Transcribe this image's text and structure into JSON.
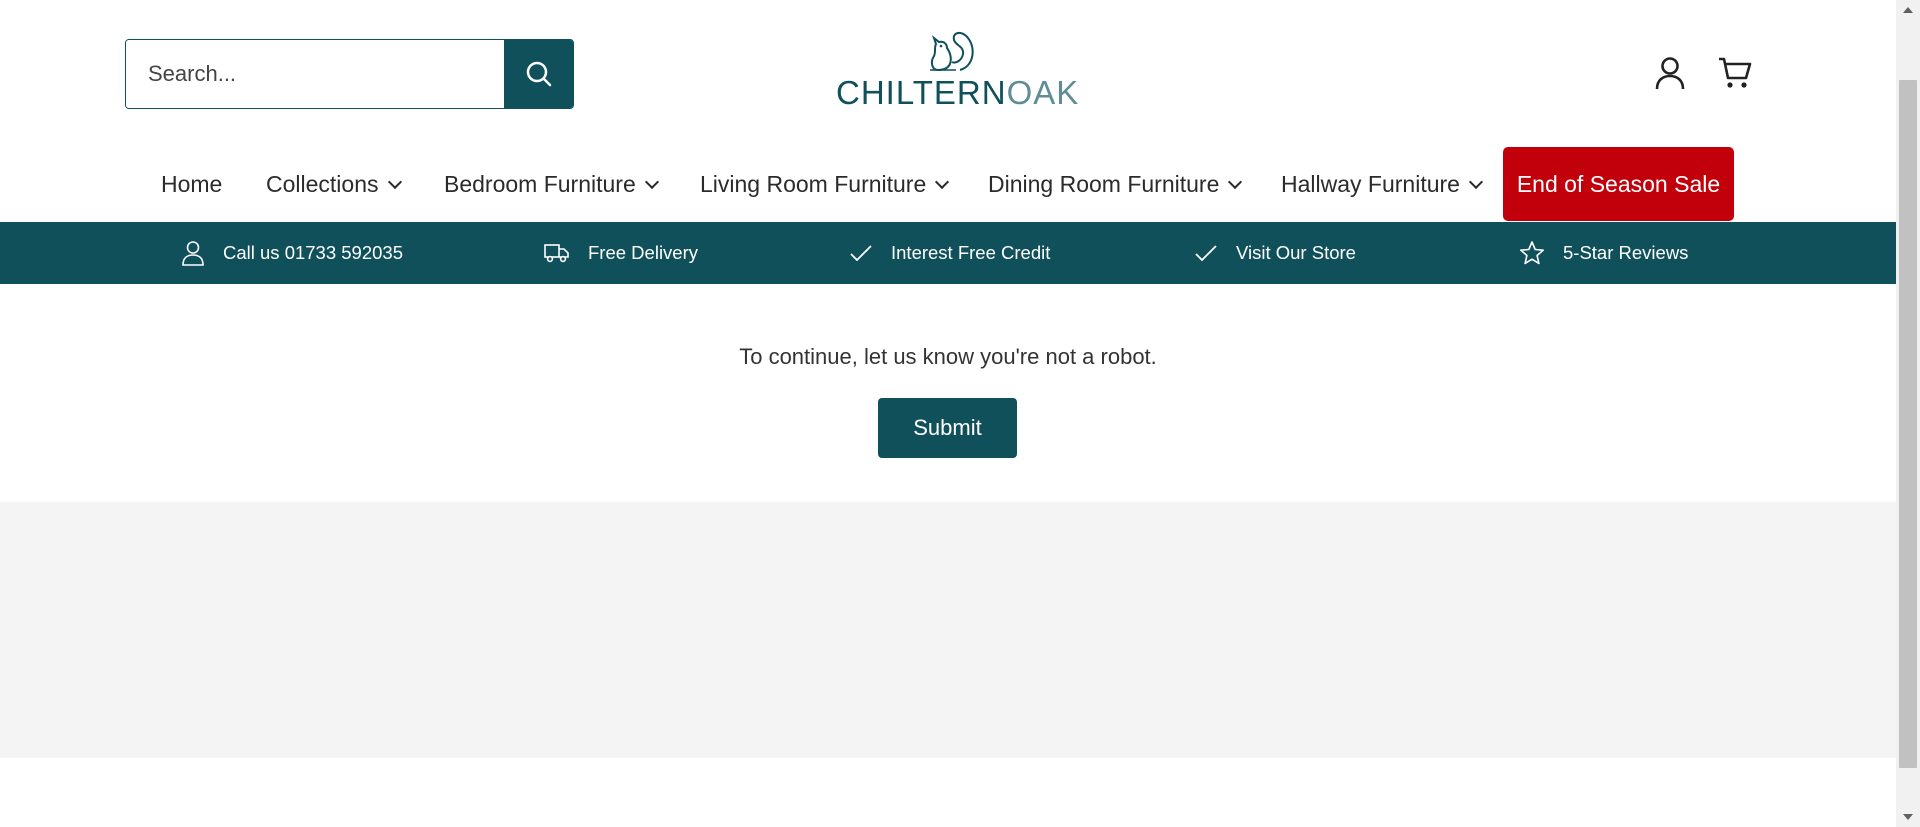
{
  "header": {
    "search": {
      "placeholder": "Search..."
    },
    "logo": {
      "part1": "CHILTERN",
      "part2": "OAK"
    }
  },
  "nav": {
    "items": [
      {
        "label": "Home",
        "has_dropdown": false
      },
      {
        "label": "Collections",
        "has_dropdown": true
      },
      {
        "label": "Bedroom Furniture",
        "has_dropdown": true
      },
      {
        "label": "Living Room Furniture",
        "has_dropdown": true
      },
      {
        "label": "Dining Room Furniture",
        "has_dropdown": true
      },
      {
        "label": "Hallway Furniture",
        "has_dropdown": true
      }
    ],
    "sale_label": "End of Season Sale"
  },
  "usp_bar": {
    "items": [
      {
        "label": "Call us 01733 592035",
        "icon": "user-icon"
      },
      {
        "label": "Free Delivery",
        "icon": "truck-icon"
      },
      {
        "label": "Interest Free Credit",
        "icon": "check-icon"
      },
      {
        "label": "Visit Our Store",
        "icon": "check-icon"
      },
      {
        "label": "5-Star Reviews",
        "icon": "star-icon"
      }
    ]
  },
  "main": {
    "message": "To continue, let us know you're not a robot.",
    "submit_label": "Submit"
  },
  "colors": {
    "brand": "#0f505a",
    "sale": "#c1000b",
    "footer_gray": "#f4f4f4"
  }
}
